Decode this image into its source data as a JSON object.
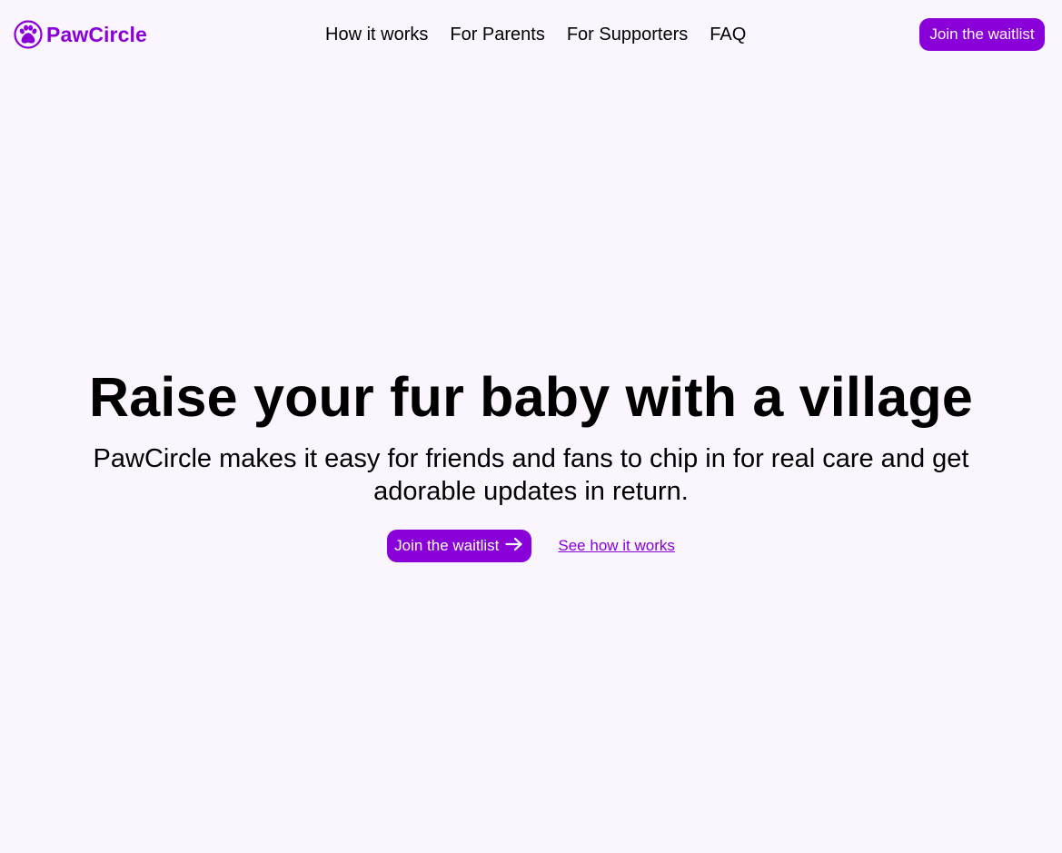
{
  "brand": {
    "name": "PawCircle",
    "logo_icon": "paw-circle-icon",
    "color": "#8a00d8"
  },
  "nav": {
    "items": [
      {
        "label": "How it works"
      },
      {
        "label": "For Parents"
      },
      {
        "label": "For Supporters"
      },
      {
        "label": "FAQ"
      }
    ],
    "cta_label": "Join the waitlist"
  },
  "hero": {
    "title": "Raise your fur baby with a village",
    "subtitle": "PawCircle makes it easy for friends and fans to chip in for real care and get adorable updates in return.",
    "primary_cta_label": "Join the waitlist",
    "primary_cta_icon": "arrow-right-icon",
    "secondary_link_label": "See how it works"
  },
  "colors": {
    "accent": "#8a00d8",
    "background": "#fbf5fd",
    "text": "#000000"
  }
}
